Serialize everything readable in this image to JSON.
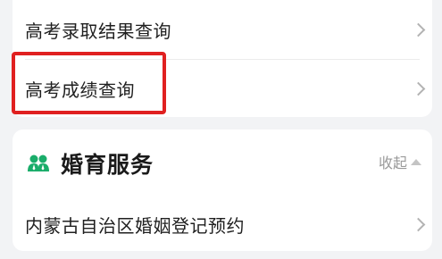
{
  "services": {
    "items": [
      {
        "label": "高考录取结果查询"
      },
      {
        "label": "高考成绩查询"
      }
    ]
  },
  "marriage_section": {
    "icon": "people-icon",
    "title": "婚育服务",
    "collapse_label": "收起",
    "items": [
      {
        "label": "内蒙古自治区婚姻登记预约"
      }
    ]
  },
  "colors": {
    "highlight": "#e02020",
    "accent_green": "#1aad6a",
    "background": "#f2f3f5"
  }
}
